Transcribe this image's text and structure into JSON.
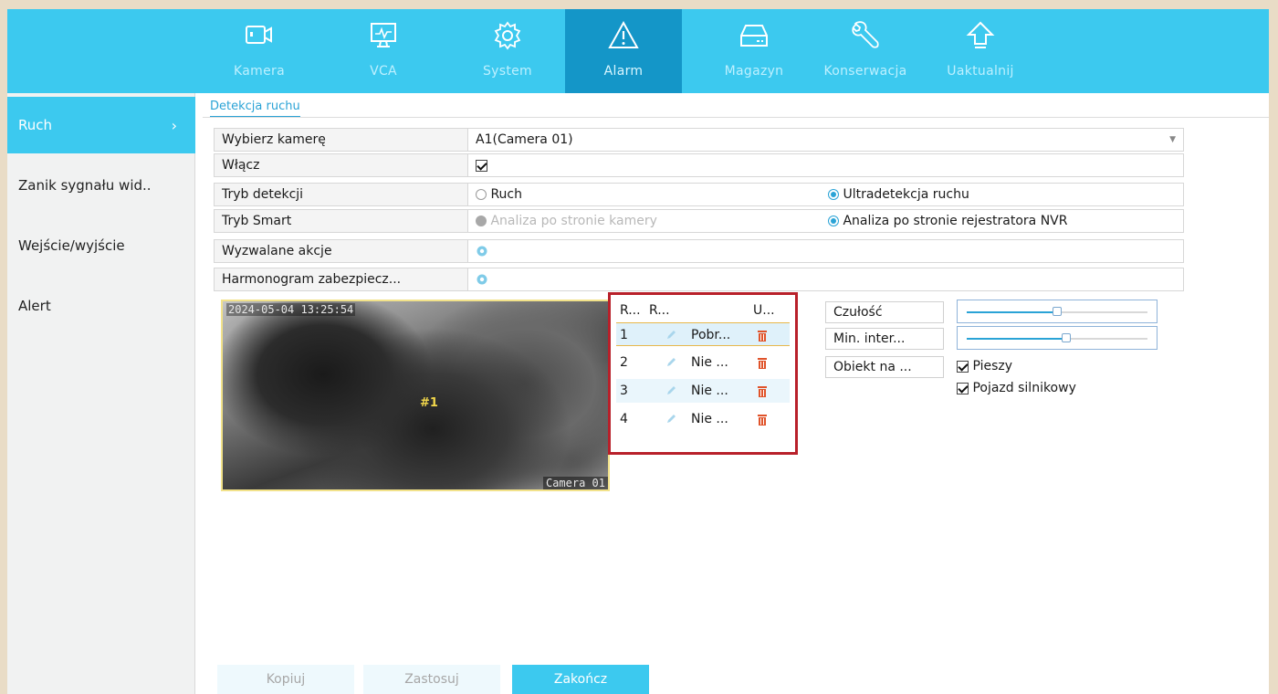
{
  "nav": {
    "items": [
      {
        "label": "Kamera",
        "icon": "camera-icon"
      },
      {
        "label": "VCA",
        "icon": "monitor-icon"
      },
      {
        "label": "System",
        "icon": "gear-icon"
      },
      {
        "label": "Alarm",
        "icon": "warning-icon"
      },
      {
        "label": "Magazyn",
        "icon": "storage-icon"
      },
      {
        "label": "Konserwacja",
        "icon": "wrench-icon"
      },
      {
        "label": "Uaktualnij",
        "icon": "upload-arrow-icon"
      }
    ],
    "active": "Alarm"
  },
  "sidebar": {
    "items": [
      {
        "label": "Ruch",
        "chevron": "›"
      },
      {
        "label": "Zanik sygnału wid.."
      },
      {
        "label": "Wejście/wyjście"
      },
      {
        "label": "Alert"
      }
    ]
  },
  "tab": {
    "label": "Detekcja ruchu"
  },
  "form": {
    "camera": {
      "label": "Wybierz kamerę",
      "value": "A1(Camera 01)"
    },
    "enable": {
      "label": "Włącz",
      "checked": true
    },
    "detection_mode": {
      "label": "Tryb detekcji",
      "option1": "Ruch",
      "option2": "Ultradetekcja ruchu",
      "selected": "Ultradetekcja ruchu"
    },
    "smart_mode": {
      "label": "Tryb Smart",
      "option1": "Analiza po stronie kamery",
      "option2": "Analiza po stronie rejestratora NVR",
      "selected": "Analiza po stronie rejestratora NVR"
    },
    "triggered_actions": {
      "label": "Wyzwalane akcje"
    },
    "schedule": {
      "label": "Harmonogram zabezpiecz..."
    }
  },
  "video": {
    "timestamp": "2024-05-04 13:25:54",
    "zone_label": "#1",
    "camera_name": "Camera 01"
  },
  "area_table": {
    "headers": [
      "R...",
      "R...",
      "U..."
    ],
    "rows": [
      {
        "num": "1",
        "name": "Pobr..."
      },
      {
        "num": "2",
        "name": "Nie ..."
      },
      {
        "num": "3",
        "name": "Nie ..."
      },
      {
        "num": "4",
        "name": "Nie ..."
      }
    ]
  },
  "settings": {
    "sensitivity": {
      "label": "Czułość",
      "level": 0.5
    },
    "min_interval": {
      "label": "Min. inter...",
      "level": 0.55
    },
    "object": {
      "label": "Obiekt na ...",
      "options": [
        "Pieszy",
        "Pojazd silnikowy"
      ]
    }
  },
  "buttons": {
    "copy": "Kopiuj",
    "apply": "Zastosuj",
    "finish": "Zakończ"
  },
  "colors": {
    "accent": "#3cc9ef",
    "active_nav": "#1496c8",
    "highlight_border": "#b8202a"
  }
}
